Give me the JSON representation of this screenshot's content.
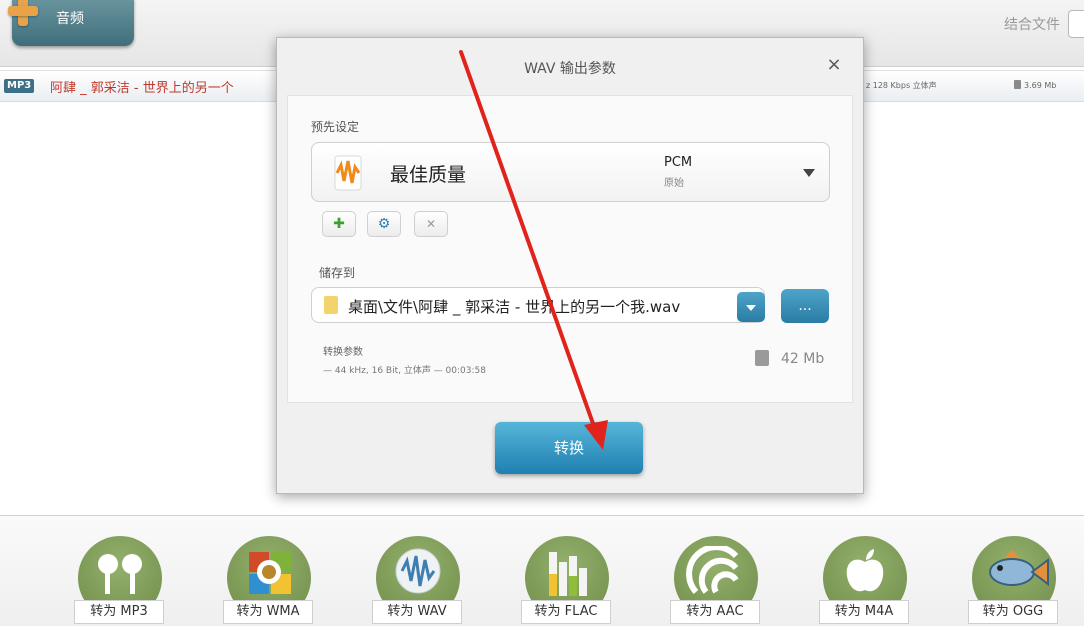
{
  "toolbar": {
    "audio_label": "音频",
    "join_files_label": "结合文件"
  },
  "file_row": {
    "tag": "MP3",
    "title": "阿肆 _ 郭采洁 - 世界上的另一个",
    "meta": "z  128 Kbps  立体声",
    "size": "3.69 Mb"
  },
  "dialog": {
    "title": "WAV 输出参数",
    "close_glyph": "×",
    "preset_label": "预先设定",
    "preset_name": "最佳质量",
    "preset_codec": "PCM",
    "preset_sub": "原始",
    "save_label": "储存到",
    "save_path": "桌面\\文件\\阿肆 _ 郭采洁 - 世界上的另一个我.wav",
    "browse_label": "...",
    "params_label": "转换参数",
    "params_value": "— 44 kHz, 16 Bit, 立体声 — 00:03:58",
    "output_size": "42 Mb",
    "convert_label": "转换"
  },
  "formats": [
    {
      "label": "转为 MP3",
      "icon": "earbuds-icon"
    },
    {
      "label": "转为 WMA",
      "icon": "windows-media-icon"
    },
    {
      "label": "转为 WAV",
      "icon": "waveform-icon"
    },
    {
      "label": "转为 FLAC",
      "icon": "equalizer-icon"
    },
    {
      "label": "转为 AAC",
      "icon": "aac-waves-icon"
    },
    {
      "label": "转为 M4A",
      "icon": "apple-icon"
    },
    {
      "label": "转为 OGG",
      "icon": "fish-icon"
    }
  ],
  "colors": {
    "accent_blue": "#2a7ca4",
    "format_green": "#7b9856",
    "annotation_red": "#e0241c",
    "file_title_red": "#c0392b"
  }
}
